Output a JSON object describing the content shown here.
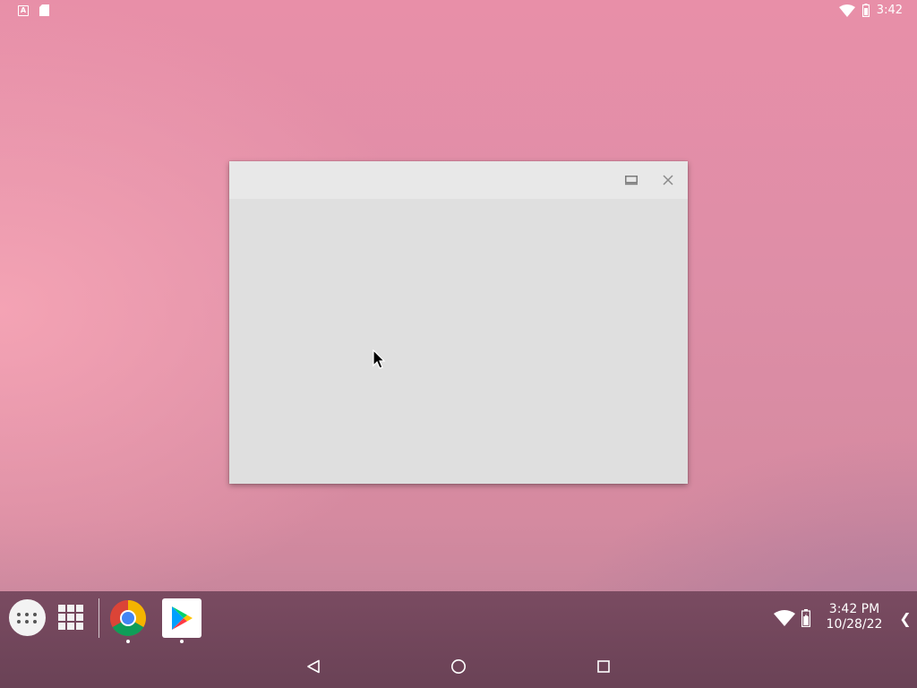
{
  "status_bar": {
    "left_icons": [
      "text-notification-icon",
      "sd-card-icon"
    ],
    "notif_letter": "A",
    "right_icons": [
      "wifi-icon",
      "battery-icon"
    ],
    "time": "3:42"
  },
  "window": {
    "caption_buttons": [
      "restore-icon",
      "close-icon"
    ]
  },
  "taskbar": {
    "apps": [
      {
        "name": "app-drawer",
        "icon": "app-drawer-dots-icon"
      },
      {
        "name": "overview",
        "icon": "grid-icon"
      },
      {
        "name": "Chrome",
        "icon": "chrome-icon",
        "running": true
      },
      {
        "name": "Play Store",
        "icon": "play-store-icon",
        "running": true
      }
    ],
    "tray": {
      "time": "3:42 PM",
      "date": "10/28/22",
      "expand_glyph": "❮"
    }
  },
  "nav_bar": {
    "buttons": [
      "back-icon",
      "home-icon",
      "recents-icon"
    ]
  },
  "colors": {
    "wallpaper": "#de8ea7",
    "taskbar": "#734659",
    "window_body": "#dfdfdf",
    "window_caption": "#e8e8e8"
  }
}
